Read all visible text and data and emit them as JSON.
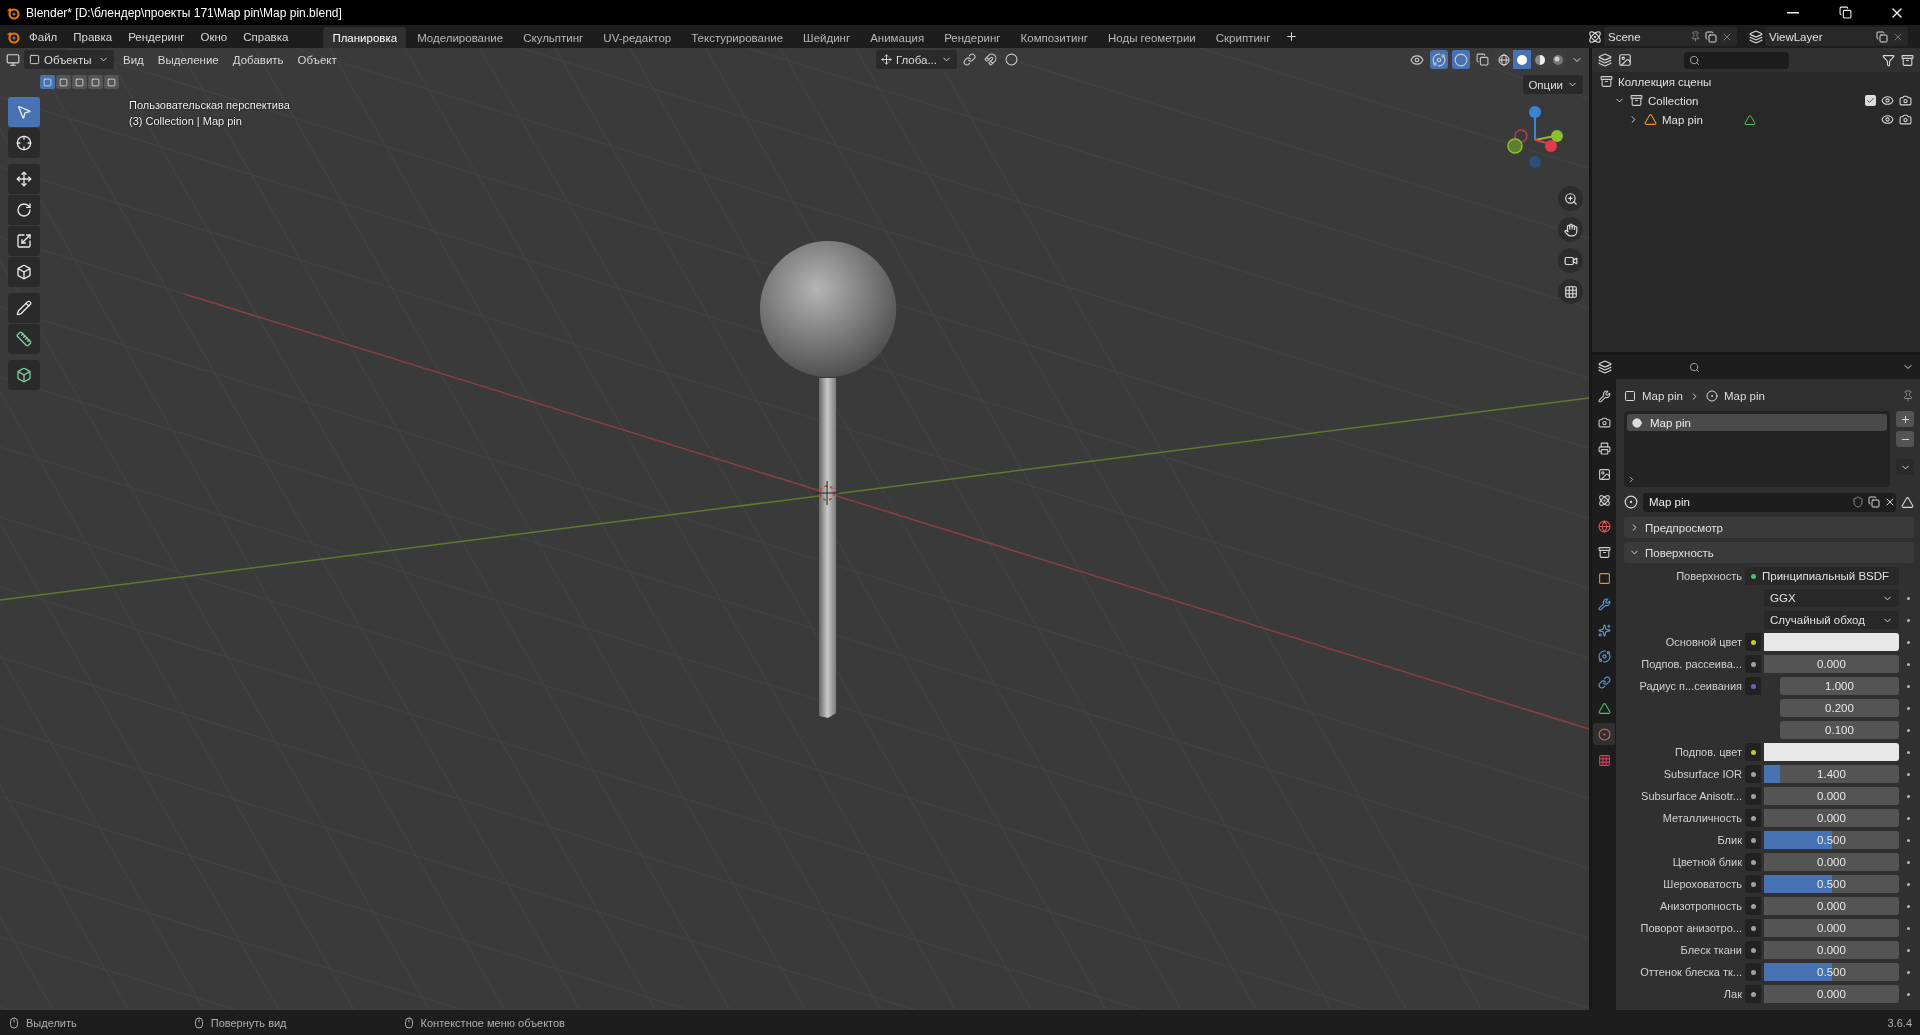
{
  "window": {
    "title": "Blender* [D:\\блендер\\проекты 171\\Map pin\\Map pin.blend]"
  },
  "menu": [
    "Файл",
    "Правка",
    "Рендеринг",
    "Окно",
    "Справка"
  ],
  "workspaces": [
    {
      "label": "Планировка",
      "selected": true
    },
    {
      "label": "Моделирование",
      "selected": false
    },
    {
      "label": "Скульптинг",
      "selected": false
    },
    {
      "label": "UV-редактор",
      "selected": false
    },
    {
      "label": "Текстурирование",
      "selected": false
    },
    {
      "label": "Шейдинг",
      "selected": false
    },
    {
      "label": "Анимация",
      "selected": false
    },
    {
      "label": "Рендеринг",
      "selected": false
    },
    {
      "label": "Композитинг",
      "selected": false
    },
    {
      "label": "Ноды геометрии",
      "selected": false
    },
    {
      "label": "Скриптинг",
      "selected": false
    }
  ],
  "scene": {
    "scene": "Scene",
    "view_layer": "ViewLayer"
  },
  "viewport": {
    "mode": "Объекты",
    "menus": [
      "Вид",
      "Выделение",
      "Добавить",
      "Объект"
    ],
    "orientation": "Глоба...",
    "select_modes": [
      {
        "selected": true
      },
      {
        "selected": false
      },
      {
        "selected": false
      },
      {
        "selected": false
      },
      {
        "selected": false
      }
    ],
    "tool_groups": [
      [
        {
          "kind": "select",
          "selected": true
        },
        {
          "kind": "cursor",
          "selected": false
        }
      ],
      [
        {
          "kind": "move",
          "selected": false
        },
        {
          "kind": "rotate",
          "selected": false
        },
        {
          "kind": "scale",
          "selected": false
        },
        {
          "kind": "transform",
          "selected": false
        }
      ],
      [
        {
          "kind": "annotate",
          "selected": false
        },
        {
          "kind": "measure",
          "selected": false
        }
      ],
      [
        {
          "kind": "add",
          "selected": false
        }
      ]
    ],
    "overlay_text": [
      "Пользовательская перспектива",
      "(3) Collection | Map pin"
    ],
    "options": "Опции",
    "shading": [
      {
        "kind": "wireframe",
        "selected": false
      },
      {
        "kind": "solid",
        "selected": true
      },
      {
        "kind": "material",
        "selected": false
      },
      {
        "kind": "rendered",
        "selected": false
      }
    ]
  },
  "outliner": {
    "items": [
      {
        "label": "Коллекция сцены",
        "kind": "scene",
        "children": [
          {
            "label": "Collection",
            "kind": "collection",
            "expanded": true,
            "checked": true,
            "children": [
              {
                "label": "Map pin",
                "kind": "object",
                "expanded": false
              }
            ]
          }
        ]
      }
    ]
  },
  "properties": {
    "tabs": [
      {
        "kind": "tool",
        "selected": false
      },
      {
        "kind": "render",
        "selected": false
      },
      {
        "kind": "output",
        "selected": false
      },
      {
        "kind": "view_layer",
        "selected": false
      },
      {
        "kind": "scene",
        "selected": false
      },
      {
        "kind": "world",
        "selected": false
      },
      {
        "kind": "collection",
        "selected": false
      },
      {
        "kind": "object",
        "selected": false
      },
      {
        "kind": "modifier",
        "selected": false
      },
      {
        "kind": "particles",
        "selected": false
      },
      {
        "kind": "physics",
        "selected": false
      },
      {
        "kind": "constraints",
        "selected": false
      },
      {
        "kind": "data",
        "selected": false
      },
      {
        "kind": "material",
        "selected": true
      },
      {
        "kind": "texture",
        "selected": false
      }
    ],
    "breadcrumb": [
      "Map pin",
      "Map pin"
    ],
    "slots": [
      {
        "label": "Map pin",
        "selected": true
      }
    ],
    "material": "Map pin",
    "panels": [
      {
        "label": "Предпросмотр",
        "expanded": false
      },
      {
        "label": "Поверхность",
        "expanded": true
      }
    ],
    "surface": {
      "label": "Поверхность",
      "value": "Принципиальный BSDF"
    },
    "dropdowns": [
      "GGX",
      "Случайный обход"
    ],
    "fields": [
      {
        "label": "Основной цвет",
        "kind": "color",
        "color": "#c7c729"
      },
      {
        "label": "Подпов. рассеива...",
        "kind": "number",
        "value": "0.000",
        "level": 0,
        "color": "#a1a1a1"
      },
      {
        "label": "Радиус п...сеивания",
        "kind": "vector",
        "values": [
          "1.000",
          "0.200",
          "0.100"
        ],
        "color": "#6363c7"
      },
      {
        "label": "Подпов. цвет",
        "kind": "color",
        "color": "#c7c729"
      },
      {
        "label": "Subsurface IOR",
        "kind": "number",
        "value": "1.400",
        "level": 0.12,
        "color": "#a1a1a1"
      },
      {
        "label": "Subsurface Anisotr...",
        "kind": "number",
        "value": "0.000",
        "level": 0,
        "color": "#a1a1a1"
      },
      {
        "label": "Металличность",
        "kind": "number",
        "value": "0.000",
        "level": 0,
        "color": "#a1a1a1"
      },
      {
        "label": "Блик",
        "kind": "number",
        "value": "0.500",
        "level": 0.5,
        "color": "#a1a1a1"
      },
      {
        "label": "Цветной блик",
        "kind": "number",
        "value": "0.000",
        "level": 0,
        "color": "#a1a1a1"
      },
      {
        "label": "Шероховатость",
        "kind": "number",
        "value": "0.500",
        "level": 0.5,
        "color": "#a1a1a1"
      },
      {
        "label": "Анизотропность",
        "kind": "number",
        "value": "0.000",
        "level": 0,
        "color": "#a1a1a1"
      },
      {
        "label": "Поворот анизотро...",
        "kind": "number",
        "value": "0.000",
        "level": 0,
        "color": "#a1a1a1"
      },
      {
        "label": "Блеск ткани",
        "kind": "number",
        "value": "0.000",
        "level": 0,
        "color": "#a1a1a1"
      },
      {
        "label": "Оттенок блеска тк...",
        "kind": "number",
        "value": "0.500",
        "level": 0.5,
        "color": "#a1a1a1"
      },
      {
        "label": "Лак",
        "kind": "number",
        "value": "0.000",
        "level": 0,
        "color": "#a1a1a1"
      }
    ]
  },
  "status_bar": {
    "hints": [
      "Выделить",
      "Повернуть вид",
      "Контекстное меню объектов"
    ],
    "version": "3.6.4"
  }
}
